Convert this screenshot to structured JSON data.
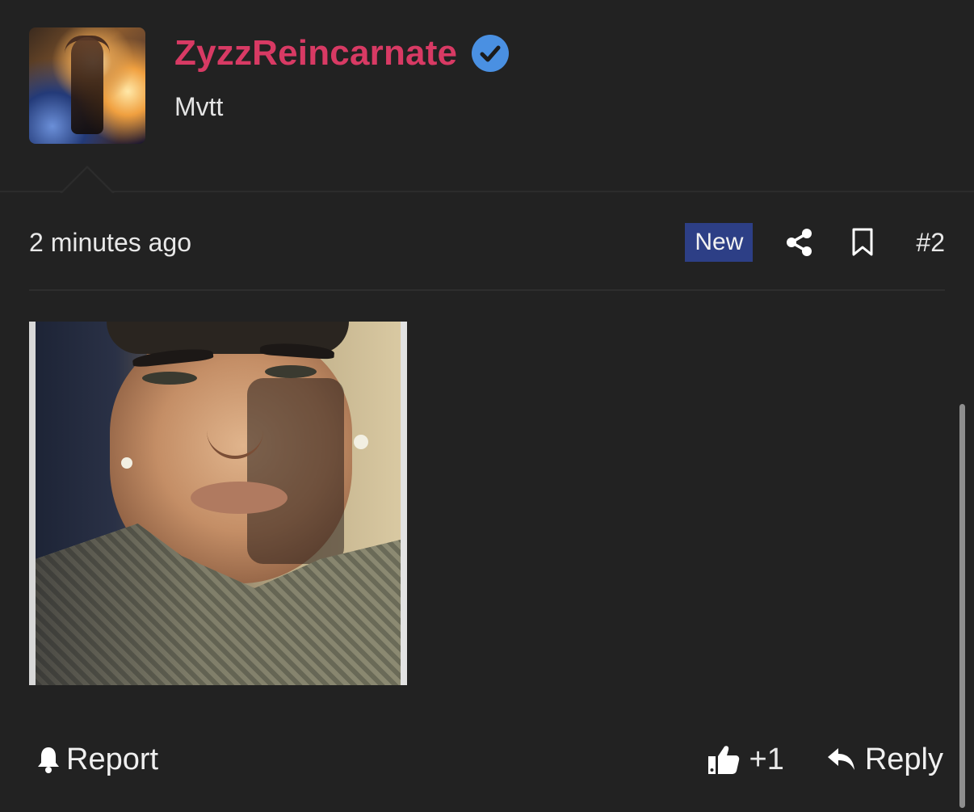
{
  "user": {
    "username": "ZyzzReincarnate",
    "subtitle": "Mvtt",
    "verified": true,
    "username_color": "#d83a64",
    "verified_color": "#4a90e2"
  },
  "post": {
    "timestamp": "2 minutes ago",
    "badge": "New",
    "badge_color": "#2d3f86",
    "number": "#2"
  },
  "actions": {
    "report_label": "Report",
    "like_count": "+1",
    "reply_label": "Reply"
  },
  "icons": {
    "verified": "verified-check-icon",
    "share": "share-icon",
    "bookmark": "bookmark-icon",
    "report": "bell-icon",
    "like": "thumbs-up-icon",
    "reply": "reply-arrow-icon"
  }
}
